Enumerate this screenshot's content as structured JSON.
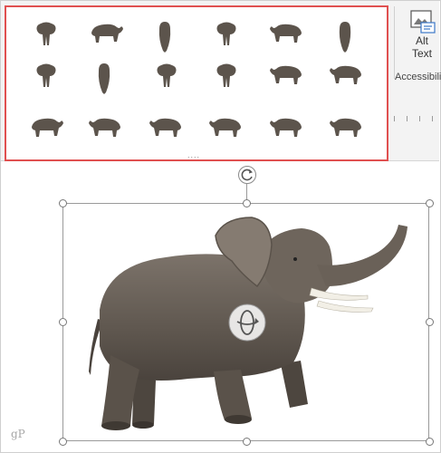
{
  "ribbon": {
    "alt_text_label_1": "Alt",
    "alt_text_label_2": "Text",
    "group_label": "Accessibili",
    "gallery_dots": "....",
    "gallery_items": [
      {
        "name": "view-front"
      },
      {
        "name": "view-walk-right"
      },
      {
        "name": "view-top"
      },
      {
        "name": "view-back"
      },
      {
        "name": "view-trumpet-left"
      },
      {
        "name": "view-top-angled"
      },
      {
        "name": "view-front-small"
      },
      {
        "name": "view-top-small"
      },
      {
        "name": "view-below"
      },
      {
        "name": "view-back-small"
      },
      {
        "name": "view-three-quarter"
      },
      {
        "name": "view-three-quarter-2"
      },
      {
        "name": "view-raised-trunk"
      },
      {
        "name": "view-raised-trunk-2"
      },
      {
        "name": "view-walk-left"
      },
      {
        "name": "view-walk-left-2"
      },
      {
        "name": "view-side-left"
      },
      {
        "name": "view-side-left-2"
      }
    ]
  },
  "canvas": {
    "selected_object": "3D elephant model",
    "watermark": "gP"
  },
  "colors": {
    "gallery_border": "#e05050",
    "elephant_skin": "#6b625a",
    "tusk": "#f2efe6"
  }
}
